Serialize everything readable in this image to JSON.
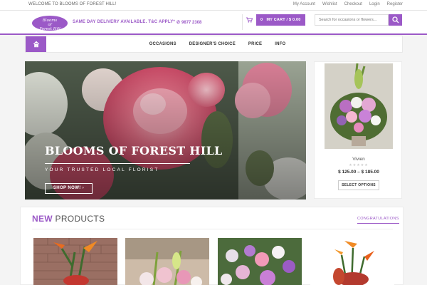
{
  "topbar": {
    "welcome": "WELCOME TO BLOOMS OF FOREST HILL!",
    "links": [
      "My Account",
      "Wishlist",
      "Checkout",
      "Login",
      "Register"
    ]
  },
  "header": {
    "logo_line1": "Blooms",
    "logo_line2": "of",
    "logo_line3": "Forest Hill",
    "delivery": "SAME DAY DELIVERY AVAILABLE. T&C APPLY*",
    "phone": "9877 2308",
    "cart_count": "0",
    "cart_label": "MY CART / $ 0.00",
    "search_placeholder": "Search for occasions or flowers..."
  },
  "nav": {
    "items": [
      "OCCASIONS",
      "DESIGNER'S CHOICE",
      "PRICE",
      "INFO"
    ]
  },
  "hero": {
    "title": "BLOOMS OF FOREST HILL",
    "subtitle": "YOUR TRUSTED LOCAL FLORIST",
    "button": "SHOP NOW! ›"
  },
  "featured": {
    "name": "Vivien",
    "stars": "★★★★★",
    "price": "$ 125.00 – $ 185.00",
    "button": "SELECT OPTIONS"
  },
  "new_products": {
    "title_highlight": "NEW",
    "title_rest": " PRODUCTS",
    "tab": "CONGRATULATIONS"
  },
  "colors": {
    "accent": "#9b59c7"
  }
}
